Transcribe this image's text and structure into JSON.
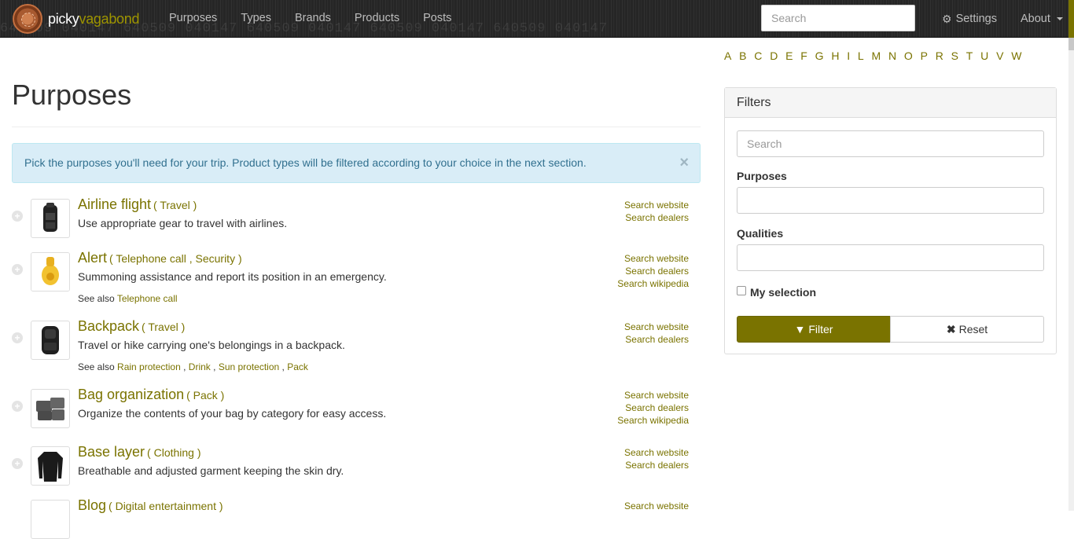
{
  "brand": {
    "part1": "picky",
    "part2": "vagabond"
  },
  "nav": {
    "links": [
      "Purposes",
      "Types",
      "Brands",
      "Products",
      "Posts"
    ],
    "search_placeholder": "Search",
    "settings_label": "Settings",
    "about_label": "About",
    "background_numbers": "640509  040147  640509  040147  640509  040147  640509  040147  640509  040147"
  },
  "page": {
    "title": "Purposes",
    "alert_text": "Pick the purposes you'll need for your trip. Product types will be filtered according to your choice in the next section.",
    "alert_close": "×"
  },
  "items": [
    {
      "title": "Airline flight",
      "categories": "( Travel )",
      "description": "Use appropriate gear to travel with airlines.",
      "see_also": [],
      "links": [
        "Search website",
        "Search dealers"
      ],
      "icon": "backpack-icon"
    },
    {
      "title": "Alert",
      "categories": "( Telephone call , Security )",
      "description": "Summoning assistance and report its position in an emergency.",
      "see_also": [
        "Telephone call"
      ],
      "links": [
        "Search website",
        "Search dealers",
        "Search wikipedia"
      ],
      "icon": "whistle-icon"
    },
    {
      "title": "Backpack",
      "categories": "( Travel )",
      "description": "Travel or hike carrying one's belongings in a backpack.",
      "see_also": [
        "Rain protection",
        "Drink",
        "Sun protection",
        "Pack"
      ],
      "links": [
        "Search website",
        "Search dealers"
      ],
      "icon": "backpack-icon"
    },
    {
      "title": "Bag organization",
      "categories": "( Pack )",
      "description": "Organize the contents of your bag by category for easy access.",
      "see_also": [],
      "links": [
        "Search website",
        "Search dealers",
        "Search wikipedia"
      ],
      "icon": "organizer-icon"
    },
    {
      "title": "Base layer",
      "categories": "( Clothing )",
      "description": "Breathable and adjusted garment keeping the skin dry.",
      "see_also": [],
      "links": [
        "Search website",
        "Search dealers"
      ],
      "icon": "shirt-icon"
    },
    {
      "title": "Blog",
      "categories": "( Digital entertainment )",
      "description": "",
      "see_also": [],
      "links": [
        "Search website"
      ],
      "icon": "blog-icon"
    }
  ],
  "see_also_label": "See also",
  "sidebar": {
    "alphabet": [
      "A",
      "B",
      "C",
      "D",
      "E",
      "F",
      "G",
      "H",
      "I",
      "L",
      "M",
      "N",
      "O",
      "P",
      "R",
      "S",
      "T",
      "U",
      "V",
      "W"
    ],
    "filters_title": "Filters",
    "search_placeholder": "Search",
    "purposes_label": "Purposes",
    "qualities_label": "Qualities",
    "my_selection_label": "My selection",
    "filter_button": "Filter",
    "reset_button": "Reset"
  },
  "colors": {
    "accent": "#7a7300",
    "navbar": "#262626",
    "alert_bg": "#d9edf7"
  }
}
